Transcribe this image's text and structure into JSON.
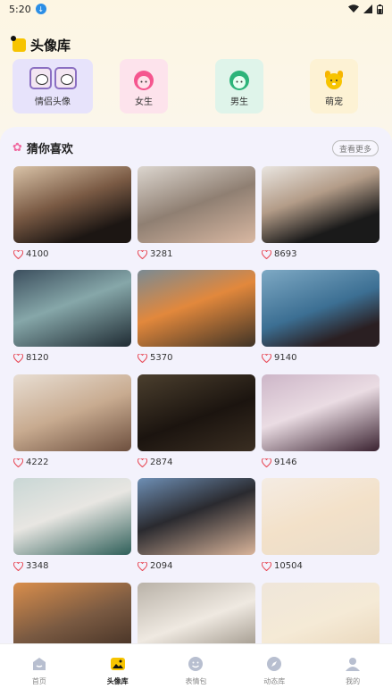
{
  "status": {
    "time": "5:20"
  },
  "library": {
    "title": "头像库",
    "categories": [
      {
        "label": "情侣头像"
      },
      {
        "label": "女生"
      },
      {
        "label": "男生"
      },
      {
        "label": "萌宠"
      }
    ]
  },
  "recommend": {
    "title": "猜你喜欢",
    "more_label": "查看更多",
    "items": [
      {
        "likes": "4100",
        "desc": "woman-black-dress"
      },
      {
        "likes": "3281",
        "desc": "girl-mirror-selfie"
      },
      {
        "likes": "8693",
        "desc": "girl-teddy-bear"
      },
      {
        "likes": "8120",
        "desc": "anime-boy"
      },
      {
        "likes": "5370",
        "desc": "girl-flowers"
      },
      {
        "likes": "9140",
        "desc": "girl-sea"
      },
      {
        "likes": "4222",
        "desc": "girl-neck-scarf"
      },
      {
        "likes": "2874",
        "desc": "girl-dark-profile"
      },
      {
        "likes": "9146",
        "desc": "girl-portrait"
      },
      {
        "likes": "3348",
        "desc": "exotic-cat"
      },
      {
        "likes": "2094",
        "desc": "boy-hand-face"
      },
      {
        "likes": "10504",
        "desc": "white-puppy"
      },
      {
        "likes": "",
        "desc": "man-sunset"
      },
      {
        "likes": "",
        "desc": "white-cat"
      },
      {
        "likes": "",
        "desc": "fluffy-dog"
      }
    ]
  },
  "tabbar": {
    "tabs": [
      {
        "label": "首页",
        "icon": "home-icon"
      },
      {
        "label": "头像库",
        "icon": "gallery-icon"
      },
      {
        "label": "表情包",
        "icon": "emoji-icon"
      },
      {
        "label": "动态库",
        "icon": "compass-icon"
      },
      {
        "label": "我的",
        "icon": "profile-icon"
      }
    ]
  }
}
